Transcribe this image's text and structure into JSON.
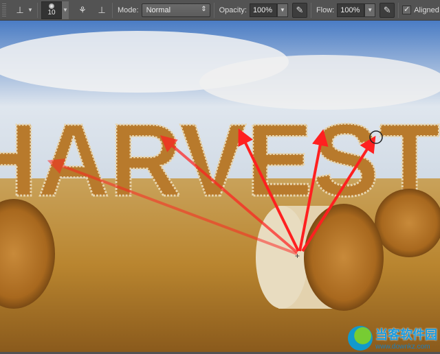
{
  "toolbar": {
    "tool_icon": "clone-stamp-icon",
    "brush_size": "10",
    "mode_label": "Mode:",
    "mode_value": "Normal",
    "opacity_label": "Opacity:",
    "opacity_value": "100%",
    "flow_label": "Flow:",
    "flow_value": "100%",
    "aligned_label": "Aligned",
    "aligned_checked": true
  },
  "canvas": {
    "headline": "HARVEST",
    "arrow_color": "#ff2020"
  },
  "watermark": {
    "name": "当客软件园",
    "url": "www.downkz.com"
  }
}
